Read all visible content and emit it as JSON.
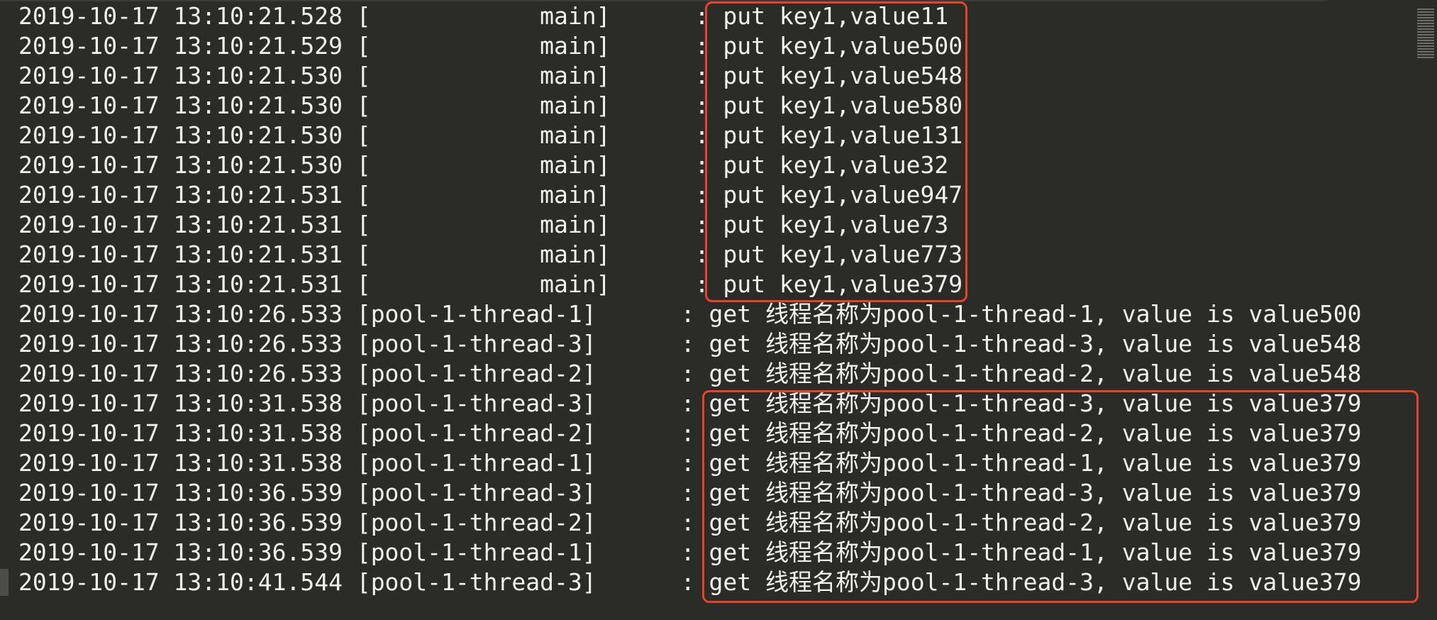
{
  "log": {
    "lines": [
      "2019-10-17 13:10:21.528 [            main]      : put key1,value11",
      "2019-10-17 13:10:21.529 [            main]      : put key1,value500",
      "2019-10-17 13:10:21.530 [            main]      : put key1,value548",
      "2019-10-17 13:10:21.530 [            main]      : put key1,value580",
      "2019-10-17 13:10:21.530 [            main]      : put key1,value131",
      "2019-10-17 13:10:21.530 [            main]      : put key1,value32",
      "2019-10-17 13:10:21.531 [            main]      : put key1,value947",
      "2019-10-17 13:10:21.531 [            main]      : put key1,value73",
      "2019-10-17 13:10:21.531 [            main]      : put key1,value773",
      "2019-10-17 13:10:21.531 [            main]      : put key1,value379",
      "2019-10-17 13:10:26.533 [pool-1-thread-1]      : get 线程名称为pool-1-thread-1, value is value500",
      "2019-10-17 13:10:26.533 [pool-1-thread-3]      : get 线程名称为pool-1-thread-3, value is value548",
      "2019-10-17 13:10:26.533 [pool-1-thread-2]      : get 线程名称为pool-1-thread-2, value is value548",
      "2019-10-17 13:10:31.538 [pool-1-thread-3]      : get 线程名称为pool-1-thread-3, value is value379",
      "2019-10-17 13:10:31.538 [pool-1-thread-2]      : get 线程名称为pool-1-thread-2, value is value379",
      "2019-10-17 13:10:31.538 [pool-1-thread-1]      : get 线程名称为pool-1-thread-1, value is value379",
      "2019-10-17 13:10:36.539 [pool-1-thread-3]      : get 线程名称为pool-1-thread-3, value is value379",
      "2019-10-17 13:10:36.539 [pool-1-thread-2]      : get 线程名称为pool-1-thread-2, value is value379",
      "2019-10-17 13:10:36.539 [pool-1-thread-1]      : get 线程名称为pool-1-thread-1, value is value379",
      "2019-10-17 13:10:41.544 [pool-1-thread-3]      : get 线程名称为pool-1-thread-3, value is value379"
    ]
  },
  "colors": {
    "background": "#2b2b28",
    "text": "#f2f2ec",
    "highlight": "#e8432a"
  }
}
